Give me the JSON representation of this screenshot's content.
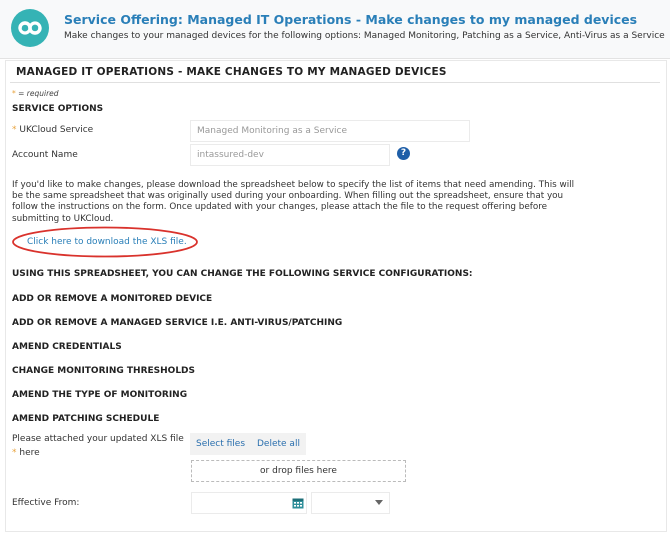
{
  "header": {
    "title": "Service Offering: Managed IT Operations - Make changes to my managed devices",
    "subtitle": "Make changes to your managed devices for the following options: Managed Monitoring, Patching as a Service, Anti-Virus as a Service",
    "logo_icon": "ukcloud-logo-icon",
    "brand_color": "#35b3b5"
  },
  "form": {
    "section_title": "MANAGED IT OPERATIONS - MAKE CHANGES TO MY MANAGED DEVICES",
    "required_marker": "*",
    "required_text": " = required",
    "service_options_heading": "SERVICE OPTIONS",
    "ukcloud_service": {
      "marker": "*",
      "label": " UKCloud Service",
      "value": "Managed Monitoring as a Service"
    },
    "account_name": {
      "label": "Account Name",
      "value": "intassured-dev",
      "help_icon": "?"
    },
    "instructions": "If you'd like to make changes, please download the spreadsheet below to specify the list of items that need amending. This will be the same spreadsheet that was originally used during your onboarding. When filling out the spreadsheet, ensure that you follow the instructions on the form. Once updated with your changes, please attach the file to the request offering before submitting to UKCloud.",
    "download_link": "Click here to download the XLS file.",
    "headings": [
      "USING THIS SPREADSHEET, YOU CAN CHANGE THE FOLLOWING SERVICE CONFIGURATIONS:",
      "ADD OR REMOVE A MONITORED DEVICE",
      "ADD OR REMOVE A MANAGED SERVICE I.E. ANTI-VIRUS/PATCHING",
      "AMEND CREDENTIALS",
      "CHANGE MONITORING THRESHOLDS",
      "AMEND THE TYPE OF MONITORING",
      "AMEND PATCHING SCHEDULE"
    ],
    "attachment": {
      "label_line1": "Please attached your updated XLS file",
      "marker": "*",
      "label_line2": " here",
      "select_files": "Select files",
      "delete_all": "Delete all",
      "drop_text": "or drop files here"
    },
    "effective_from": {
      "label": "Effective From:",
      "date_value": "",
      "select_value": "",
      "calendar_icon": "calendar-icon"
    }
  }
}
